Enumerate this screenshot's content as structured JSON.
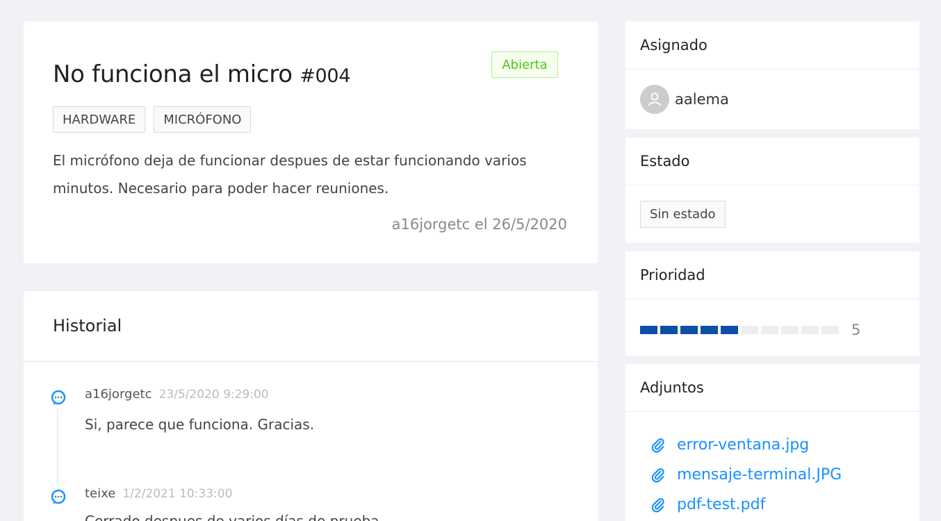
{
  "ticket": {
    "title": "No funciona el micro",
    "number": "#004",
    "status": "Abierta",
    "tags": [
      "HARDWARE",
      "MICRÓFONO"
    ],
    "description": "El micrófono deja de funcionar despues de estar funcionando varios minutos. Necesario para poder hacer reuniones.",
    "meta": "a16jorgetc el 26/5/2020"
  },
  "history": {
    "title": "Historial",
    "entries": [
      {
        "author": "a16jorgetc",
        "date": "23/5/2020 9:29:00",
        "text": "Si, parece que funciona. Gracias."
      },
      {
        "author": "teixe",
        "date": "1/2/2021 10:33:00",
        "text": "Cerrado despues de varios días de prueba."
      }
    ]
  },
  "sidebar": {
    "assigned": {
      "title": "Asignado",
      "user": "aalema"
    },
    "status": {
      "title": "Estado",
      "value": "Sin estado"
    },
    "priority": {
      "title": "Prioridad",
      "value": "5",
      "level": 5,
      "max": 10
    },
    "attachments": {
      "title": "Adjuntos",
      "files": [
        "error-ventana.jpg",
        "mensaje-terminal.JPG",
        "pdf-test.pdf"
      ]
    }
  },
  "colors": {
    "accent": "#1890ff",
    "priority_fill": "#0d4ea6",
    "status_open": "#52c41a"
  },
  "icons": {
    "history_entry": "comment-icon",
    "avatar": "user-icon",
    "attachment": "paperclip-icon"
  }
}
